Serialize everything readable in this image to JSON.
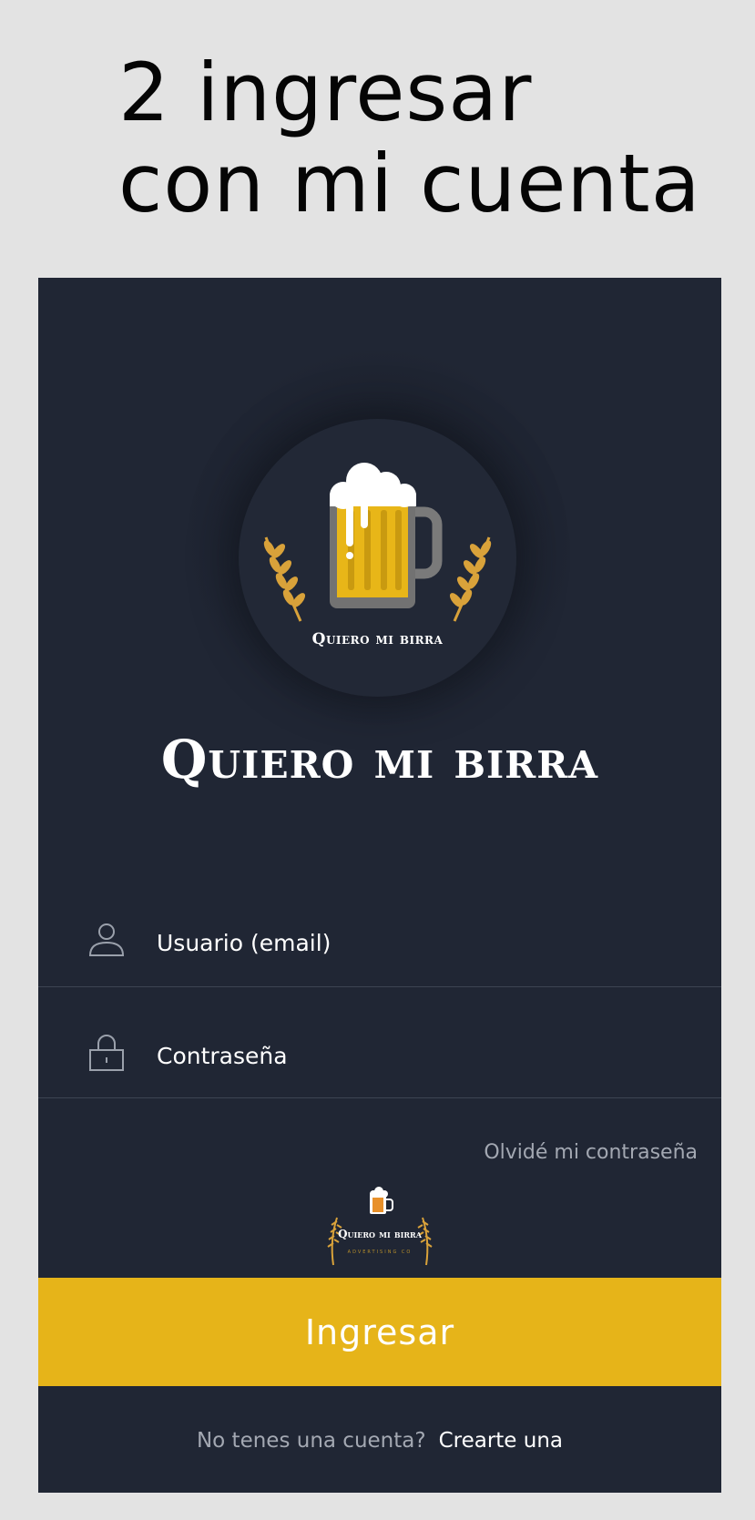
{
  "heading": {
    "line1": "2 ingresar",
    "line2": "con mi cuenta"
  },
  "logo": {
    "caption": "Quiero mi birra"
  },
  "brand": {
    "title": "Quiero mi birra"
  },
  "form": {
    "username_label": "Usuario (email)",
    "password_label": "Contraseña",
    "forgot_link": "Olvidé mi contraseña"
  },
  "footer_logo": {
    "name": "Quiero mi birra",
    "tagline": "ADVERTISING CO"
  },
  "login_button": {
    "label": "Ingresar"
  },
  "signup": {
    "question": "No tenes una cuenta?",
    "link": "Crearte una"
  },
  "icons": {
    "user": "user-icon",
    "lock": "lock-icon",
    "beer": "beer-mug-icon",
    "wheat": "wheat-icon"
  },
  "colors": {
    "background": "#e3e3e3",
    "panel": "#202634",
    "accent": "#e6b419",
    "wheat": "#d9a23a",
    "text_muted": "#a3a8b2"
  }
}
